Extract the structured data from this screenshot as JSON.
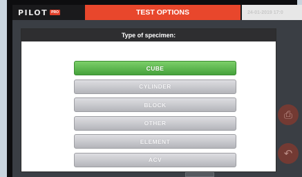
{
  "header": {
    "logo": "PILOT",
    "logo_badge": "PRO",
    "title": "TEST OPTIONS",
    "datetime": "24-01-2019 17:0"
  },
  "dialog": {
    "title": "Type of specimen:",
    "options": [
      {
        "label": "CUBE",
        "selected": true
      },
      {
        "label": "CYLINDER",
        "selected": false
      },
      {
        "label": "BLOCK",
        "selected": false
      },
      {
        "label": "OTHER",
        "selected": false
      },
      {
        "label": "ELEMENT",
        "selected": false
      },
      {
        "label": "ACV",
        "selected": false
      }
    ]
  },
  "background_icons": [
    "print-icon",
    "back-icon"
  ],
  "colors": {
    "accent": "#e8472c",
    "selected": "#5fb84d",
    "button": "#c6c7cc"
  }
}
